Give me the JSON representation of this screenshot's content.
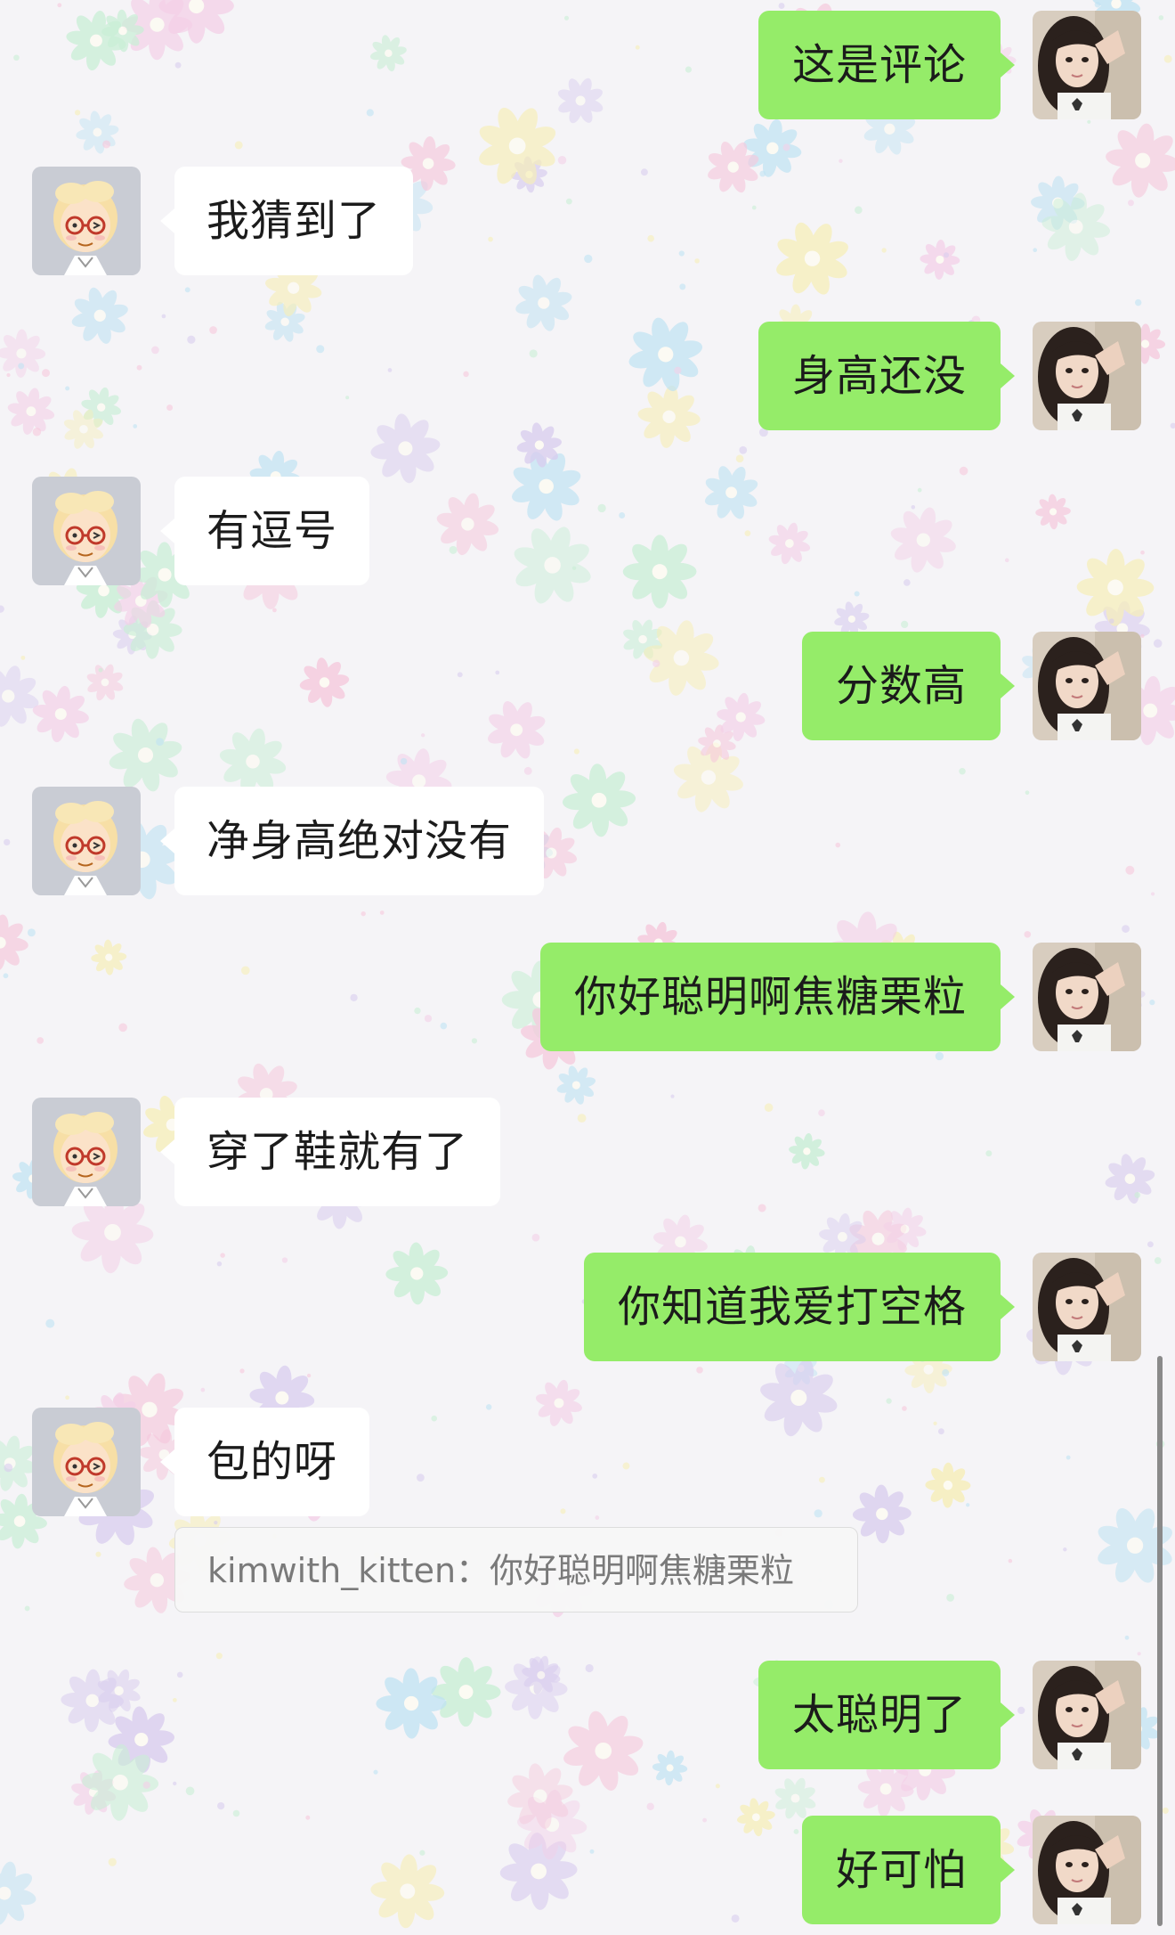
{
  "chat": {
    "messages": [
      {
        "side": "out",
        "text": "这是评论"
      },
      {
        "side": "in",
        "text": "我猜到了"
      },
      {
        "side": "out",
        "text": "身高还没"
      },
      {
        "side": "in",
        "text": "有逗号"
      },
      {
        "side": "out",
        "text": "分数高"
      },
      {
        "side": "in",
        "text": "净身高绝对没有"
      },
      {
        "side": "out",
        "text": "你好聪明啊焦糖栗粒"
      },
      {
        "side": "in",
        "text": "穿了鞋就有了"
      },
      {
        "side": "out",
        "text": "你知道我爱打空格"
      },
      {
        "side": "in",
        "text": "包的呀"
      },
      {
        "side": "out",
        "text": "太聪明了"
      },
      {
        "side": "out",
        "text": "好可怕"
      }
    ],
    "quote": {
      "sender": "kimwith_kitten：",
      "text": "你好聪明啊焦糖栗粒"
    }
  },
  "colors": {
    "outgoing_bubble": "#95ec69",
    "incoming_bubble": "#ffffff"
  },
  "icons": {
    "self_avatar": "girl-photo-avatar",
    "other_avatar": "memoji-avatar"
  }
}
